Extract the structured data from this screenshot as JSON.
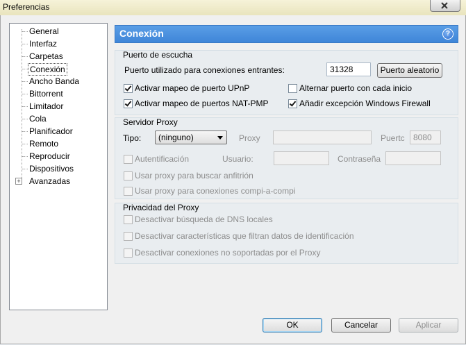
{
  "window": {
    "title": "Preferencias"
  },
  "tree": {
    "items": [
      {
        "label": "General"
      },
      {
        "label": "Interfaz"
      },
      {
        "label": "Carpetas"
      },
      {
        "label": "Conexión"
      },
      {
        "label": "Ancho Banda"
      },
      {
        "label": "Bittorrent"
      },
      {
        "label": "Limitador"
      },
      {
        "label": "Cola"
      },
      {
        "label": "Planificador"
      },
      {
        "label": "Remoto"
      },
      {
        "label": "Reproducir"
      },
      {
        "label": "Dispositivos"
      },
      {
        "label": "Avanzadas"
      }
    ],
    "selected": "Conexión",
    "expander_symbol": "+"
  },
  "panel": {
    "title": "Conexión",
    "help_symbol": "?"
  },
  "listen_port": {
    "title": "Puerto de escucha",
    "port_label": "Puerto utilizado para conexiones entrantes:",
    "port_value": "31328",
    "random_button": "Puerto aleatorio",
    "upnp": {
      "label": "Activar mapeo de puerto UPnP",
      "checked": true
    },
    "natpmp": {
      "label": "Activar mapeo de puertos NAT-PMP",
      "checked": true
    },
    "alternate": {
      "label": "Alternar puerto con cada inicio",
      "checked": false
    },
    "firewall": {
      "label": "Añadir excepción Windows Firewall",
      "checked": true
    }
  },
  "proxy_server": {
    "title": "Servidor Proxy",
    "type_label": "Tipo:",
    "type_value": "(ninguno)",
    "proxy_label": "Proxy",
    "proxy_value": "",
    "port_label": "Puertc",
    "port_value": "8080",
    "auth": {
      "label": "Autentificación",
      "checked": false
    },
    "user_label": "Usuario:",
    "user_value": "",
    "password_label": "Contraseña",
    "password_value": "",
    "hostname_lookup": {
      "label": "Usar proxy para buscar anfitrión",
      "checked": false
    },
    "p2p": {
      "label": "Usar proxy para conexiones compi-a-compi",
      "checked": false
    }
  },
  "proxy_privacy": {
    "title": "Privacidad del Proxy",
    "dns": {
      "label": "Desactivar búsqueda de DNS locales",
      "checked": false
    },
    "identifying": {
      "label": "Desactivar características que filtran datos de identificación",
      "checked": false
    },
    "unsupported": {
      "label": "Desactivar conexiones no soportadas por el Proxy",
      "checked": false
    }
  },
  "buttons": {
    "ok": "OK",
    "cancel": "Cancelar",
    "apply": "Aplicar"
  }
}
